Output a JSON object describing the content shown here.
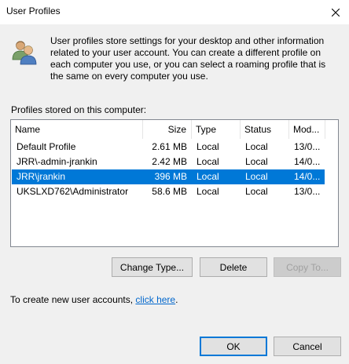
{
  "window": {
    "title": "User Profiles"
  },
  "description": "User profiles store settings for your desktop and other information related to your user account. You can create a different profile on each computer you use, or you can select a roaming profile that is the same on every computer you use.",
  "profiles_label": "Profiles stored on this computer:",
  "list": {
    "columns": [
      "Name",
      "Size",
      "Type",
      "Status",
      "Mod..."
    ],
    "rows": [
      {
        "name": "Default Profile",
        "size": "2.61 MB",
        "type": "Local",
        "status": "Local",
        "modified": "13/0...",
        "selected": false
      },
      {
        "name": "JRR\\-admin-jrankin",
        "size": "2.42 MB",
        "type": "Local",
        "status": "Local",
        "modified": "14/0...",
        "selected": false
      },
      {
        "name": "JRR\\jrankin",
        "size": "396 MB",
        "type": "Local",
        "status": "Local",
        "modified": "14/0...",
        "selected": true
      },
      {
        "name": "UKSLXD762\\Administrator",
        "size": "58.6 MB",
        "type": "Local",
        "status": "Local",
        "modified": "13/0...",
        "selected": false
      }
    ]
  },
  "buttons": {
    "change_type": "Change Type...",
    "delete": "Delete",
    "copy_to": "Copy To...",
    "ok": "OK",
    "cancel": "Cancel"
  },
  "create_text": "To create new user accounts, ",
  "create_link": "click here",
  "create_suffix": ".",
  "colors": {
    "selection": "#0078d7",
    "link": "#0066cc"
  },
  "icons": {
    "title_close": "close-icon",
    "header": "users-icon"
  }
}
